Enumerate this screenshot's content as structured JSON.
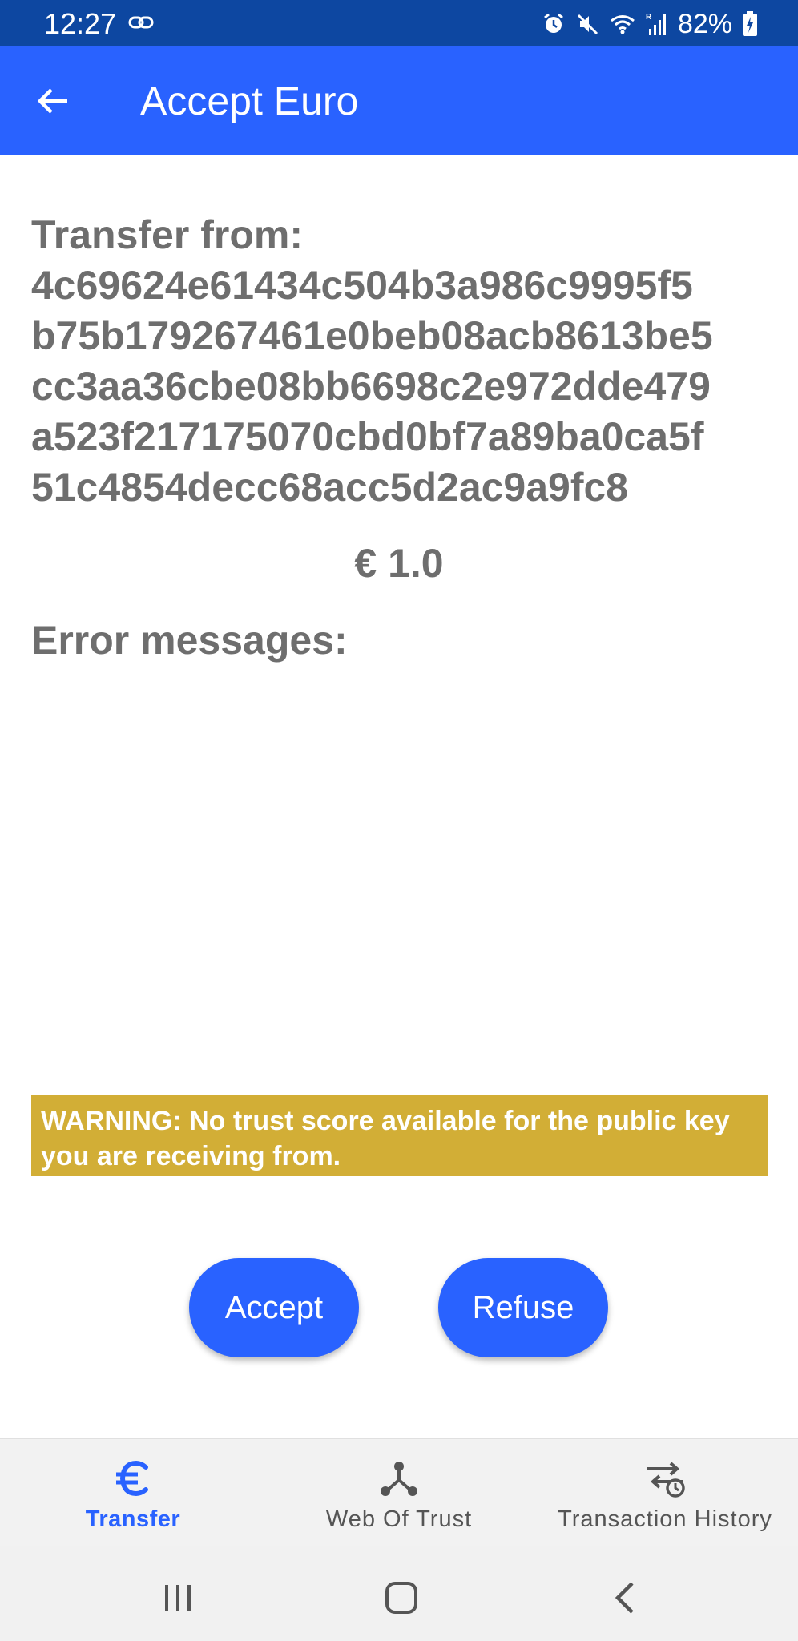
{
  "status_bar": {
    "time": "12:27",
    "battery": "82%",
    "icons": [
      "link-icon",
      "alarm-icon",
      "mute-icon",
      "wifi-icon",
      "signal-icon",
      "battery-icon"
    ]
  },
  "app_bar": {
    "title": "Accept Euro",
    "back_icon": "arrow-back-icon"
  },
  "transfer": {
    "label": "Transfer from:",
    "key_lines": [
      "4c69624e61434c504b3a986c9995f5",
      "b75b179267461e0beb08acb8613be5",
      "cc3aa36cbe08bb6698c2e972dde479",
      "a523f217175070cbd0bf7a89ba0ca5f",
      "51c4854decc68acc5d2ac9a9fc8"
    ],
    "amount": "€ 1.0"
  },
  "errors": {
    "label": "Error messages:"
  },
  "warning": {
    "text": "WARNING: No trust score available for the public key you are receiving from.",
    "color": "#d2ae36"
  },
  "actions": {
    "accept_label": "Accept",
    "refuse_label": "Refuse"
  },
  "bottom_nav": {
    "items": [
      {
        "label": "Transfer",
        "icon": "euro-icon",
        "active": true
      },
      {
        "label": "Web Of Trust",
        "icon": "network-icon",
        "active": false
      },
      {
        "label": "Transaction History",
        "icon": "history-icon",
        "active": false
      }
    ]
  },
  "colors": {
    "status_bar": "#0d47a1",
    "primary": "#2962ff",
    "text_grey": "#6e6e6e",
    "warning": "#d2ae36",
    "nav_background": "#f2f2f2"
  }
}
